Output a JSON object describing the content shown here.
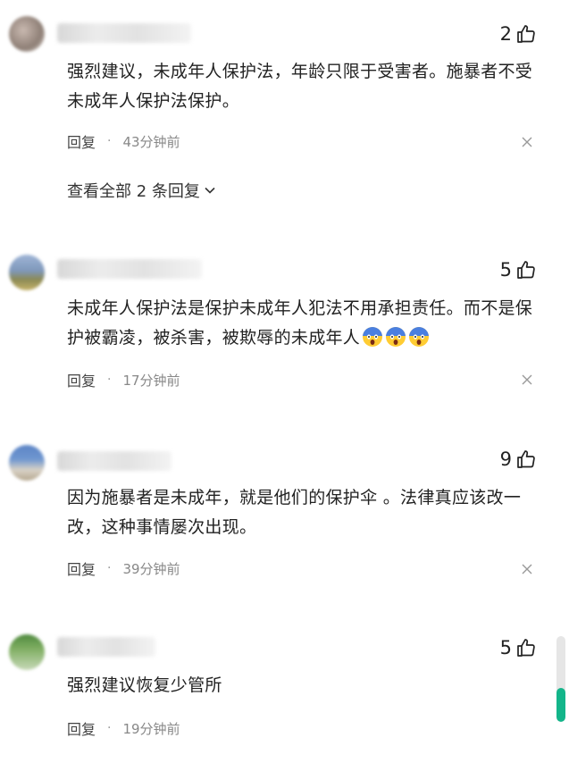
{
  "comments": [
    {
      "likes": "2",
      "text": "强烈建议，未成年人保护法，年龄只限于受害者。施暴者不受未成年人保护法保护。",
      "reply_label": "回复",
      "separator": "·",
      "time": "43分钟前"
    },
    {
      "likes": "5",
      "text": "未成年人保护法是保护未成年人犯法不用承担责任。而不是保护被霸凌，被杀害，被欺辱的未成年人",
      "emojis": [
        "scream-emoji",
        "scream-emoji",
        "scream-emoji"
      ],
      "reply_label": "回复",
      "separator": "·",
      "time": "17分钟前"
    },
    {
      "likes": "9",
      "text": "因为施暴者是未成年，就是他们的保护伞 。法律真应该改一改，这种事情屡次出现。",
      "reply_label": "回复",
      "separator": "·",
      "time": "39分钟前"
    },
    {
      "likes": "5",
      "text": "强烈建议恢复少管所",
      "reply_label": "回复",
      "separator": "·",
      "time": "19分钟前"
    }
  ],
  "view_all_replies": "查看全部 2 条回复",
  "icons": {
    "like": "thumbs-up-icon",
    "close": "close-icon",
    "expand": "chevron-down-icon"
  },
  "colors": {
    "accent": "#13b58a",
    "text": "#222222",
    "muted": "#888888"
  }
}
